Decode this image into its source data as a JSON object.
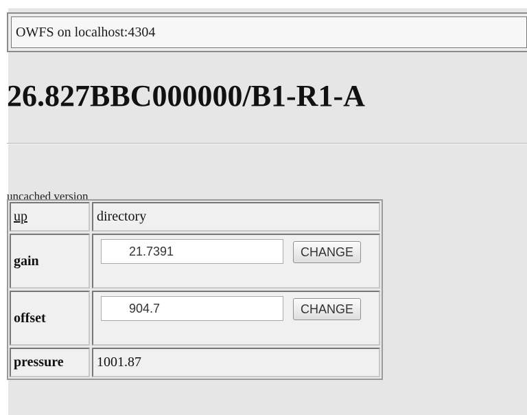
{
  "header": {
    "banner_text": "OWFS on localhost:4304",
    "title": "26.827BBC000000/B1-R1-A"
  },
  "links": {
    "uncached_version": "uncached version"
  },
  "table": {
    "up_label": "up",
    "directory_label": "directory",
    "gain": {
      "label": "gain",
      "value": "21.7391",
      "button_label": "CHANGE"
    },
    "offset": {
      "label": "offset",
      "value": "904.7",
      "button_label": "CHANGE"
    },
    "pressure": {
      "label": "pressure",
      "value": "1001.87"
    }
  }
}
